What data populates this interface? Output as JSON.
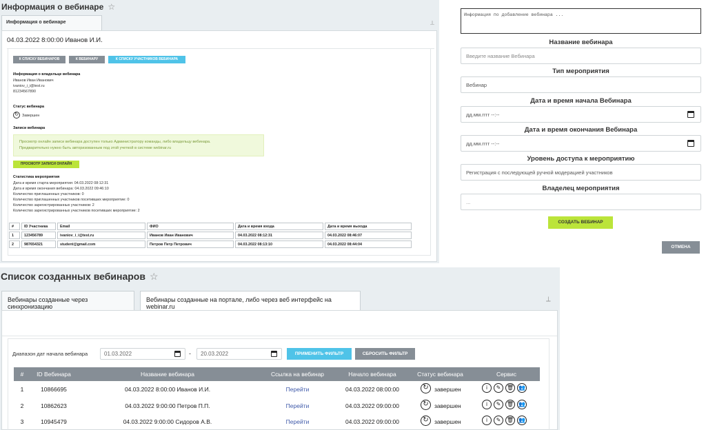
{
  "info": {
    "title": "Информация о вебинаре",
    "tab_label": "Информация о вебинаре",
    "headline": "04.03.2022 8:00:00 Иванов И.И.",
    "buttons": {
      "to_list": "К списку вебинаров",
      "to_webinar": "К вебинару",
      "to_participants": "К списку участников вебинара"
    },
    "owner": {
      "heading": "Информация о владельце вебинара",
      "name": "Иванов Иван Иванович",
      "email": "ivaniov_i_i@test.ru",
      "phone": "81234567890"
    },
    "status": {
      "heading": "Статус вебинара",
      "value": "Завершен"
    },
    "records": {
      "heading": "Записи вебинара",
      "notice_line1": "Просмотр онлайн записи вебинара доступен только Администратору команды, либо владельцу вебинара.",
      "notice_line2": "Предварительно нужно быть авторизованным под этой учеткой в системе webinar.ru",
      "button": "Просмотр записи онлайн"
    },
    "stats": {
      "heading": "Статистика мероприятия",
      "lines": [
        "Дата и время старта мероприятия: 04.03.2022 08:12:31",
        "Дата и время окончания вебинара: 04.03.2022 09:46:10",
        "Количество приглашенных участников: 0",
        "Количество приглашенных участников посетивших мероприятие: 0",
        "Количество зарегистрированных участников: 2",
        "Количество зарегистрированных участников посетивших мероприятие: 2"
      ]
    },
    "table": {
      "headers": [
        "#",
        "ID Участника",
        "Email",
        "ФИО",
        "Дата и время входа",
        "Дата и время выхода"
      ],
      "rows": [
        [
          "1",
          "123456789",
          "ivaniov_i_i@test.ru",
          "Иванов Иван Иванович",
          "04.03.2022 08:12:31",
          "04.03.2022 08:46:07"
        ],
        [
          "2",
          "987654321",
          "student@gmail.com",
          "Петров Петр Петрович",
          "04.03.2022 08:13:10",
          "04.03.2022 08:44:04"
        ]
      ]
    }
  },
  "form": {
    "info_placeholder": "Информация по добавление вебинара ...",
    "name_label": "Название вебинара",
    "name_placeholder": "Введите название Вебинара",
    "type_label": "Тип мероприятия",
    "type_value": "Вебинар",
    "start_label": "Дата и время начала Вебинара",
    "start_placeholder": "дд.мм.гггг --:--",
    "end_label": "Дата и время окончания Вебинара",
    "end_placeholder": "дд.мм.гггг --:--",
    "access_label": "Уровень доступа к мероприятию",
    "access_value": "Регистрация с последующей ручной модерацией участников",
    "owner_label": "Владелец мероприятия",
    "owner_value": "...",
    "create_button": "Создать вебинар",
    "cancel_button": "Отмена"
  },
  "list": {
    "title": "Список созданных вебинаров",
    "tabs": [
      "Вебинары созданные через синхронизацию",
      "Вебинары созданные на портале, либо через веб интерфейс на webinar.ru"
    ],
    "filter": {
      "label": "Диапазон дат начала вебинара",
      "from": "01.03.2022",
      "to": "20.03.2022",
      "dash": "-",
      "apply": "Применить фильтр",
      "reset": "Сбросить фильтр"
    },
    "columns": [
      "#",
      "ID Вебинара",
      "Название вебинара",
      "Ссылка на вебинар",
      "Начало вебинара",
      "Статус вебинара",
      "Сервис"
    ],
    "rows": [
      {
        "num": "1",
        "id": "10866695",
        "name": "04.03.2022 8:00:00 Иванов И.И.",
        "link": "Перейти",
        "start": "04.03.2022 08:00:00",
        "status": "завершен"
      },
      {
        "num": "2",
        "id": "10862623",
        "name": "04.03.2022 9:00:00 Петров П.П.",
        "link": "Перейти",
        "start": "04.03.2022 09:00:00",
        "status": "завершен"
      },
      {
        "num": "3",
        "id": "10945479",
        "name": "04.03.2022 9:00:00 Сидоров А.В.",
        "link": "Перейти",
        "start": "04.03.2022 09:00:00",
        "status": "завершен"
      }
    ]
  },
  "icons": {
    "star": "star-icon",
    "pin": "pin-icon",
    "calendar": "calendar-icon",
    "status": "refresh-icon",
    "service": [
      "info-icon",
      "edit-icon",
      "delete-icon",
      "users-icon"
    ]
  },
  "colors": {
    "panel_bg": "#e9eef1",
    "button_grey": "#868e96",
    "button_blue": "#4fc3e8",
    "button_green": "#bbe43a",
    "link": "#3c57a8",
    "notice_bg": "#f0f9dc"
  }
}
